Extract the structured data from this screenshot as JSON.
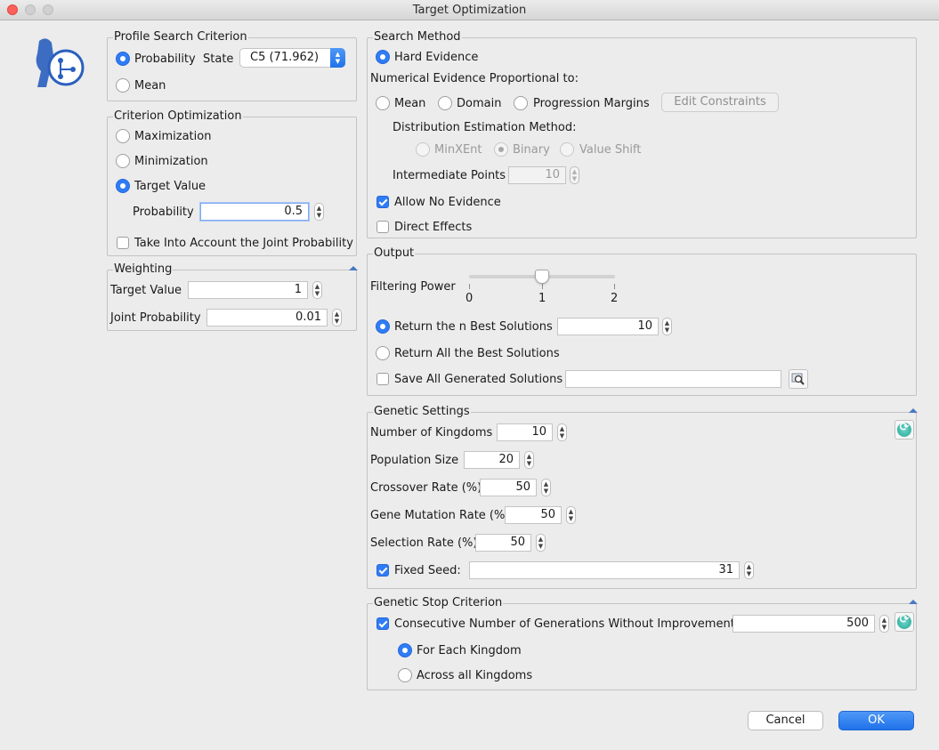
{
  "window": {
    "title": "Target Optimization"
  },
  "profile_search": {
    "title": "Profile Search Criterion",
    "probability_label": "Probability",
    "state_label": "State",
    "state_value": "C5 (71.962)",
    "mean_label": "Mean",
    "selected": "Probability"
  },
  "criterion_opt": {
    "title": "Criterion Optimization",
    "maximization": "Maximization",
    "minimization": "Minimization",
    "target_value": "Target Value",
    "probability_label": "Probability",
    "probability_value": "0.5",
    "joint_label": "Take Into Account the Joint Probability",
    "selected": "Target Value"
  },
  "weighting": {
    "title": "Weighting",
    "target_label": "Target Value",
    "target_value": "1",
    "joint_label": "Joint Probability",
    "joint_value": "0.01"
  },
  "search_method": {
    "title": "Search Method",
    "hard_evidence": "Hard Evidence",
    "numerical_label": "Numerical Evidence Proportional to:",
    "mean": "Mean",
    "domain": "Domain",
    "progression": "Progression Margins",
    "edit_constraints": "Edit Constraints",
    "distribution_label": "Distribution Estimation Method:",
    "minxent": "MinXEnt",
    "binary": "Binary",
    "value_shift": "Value Shift",
    "intermediate_label": "Intermediate Points",
    "intermediate_value": "10",
    "allow_no_evidence": "Allow No Evidence",
    "allow_no_evidence_checked": true,
    "direct_effects": "Direct Effects",
    "direct_effects_checked": false
  },
  "output": {
    "title": "Output",
    "filtering_label": "Filtering Power",
    "slider_ticks": [
      "0",
      "1",
      "2"
    ],
    "slider_value": 1,
    "slider_min": 0,
    "slider_max": 2,
    "return_n": "Return the n Best Solutions",
    "return_n_value": "10",
    "return_all": "Return All the Best Solutions",
    "save_all": "Save All Generated Solutions",
    "save_path": ""
  },
  "genetic_settings": {
    "title": "Genetic Settings",
    "kingdoms_label": "Number of Kingdoms",
    "kingdoms_value": "10",
    "population_label": "Population Size",
    "population_value": "20",
    "crossover_label": "Crossover Rate (%)",
    "crossover_value": "50",
    "mutation_label": "Gene Mutation Rate (%)",
    "mutation_value": "50",
    "selection_label": "Selection Rate (%)",
    "selection_value": "50",
    "fixed_seed_label": "Fixed Seed:",
    "fixed_seed_checked": true,
    "fixed_seed_value": "31"
  },
  "stop_criterion": {
    "title": "Genetic Stop Criterion",
    "consecutive_label": "Consecutive Number of Generations Without Improvement",
    "consecutive_checked": true,
    "consecutive_value": "500",
    "for_each": "For Each Kingdom",
    "across_all": "Across all Kingdoms"
  },
  "buttons": {
    "cancel": "Cancel",
    "ok": "OK"
  },
  "colors": {
    "accent": "#2f7cf6",
    "refresh": "#23a596",
    "logo": "#2a5fbf"
  }
}
